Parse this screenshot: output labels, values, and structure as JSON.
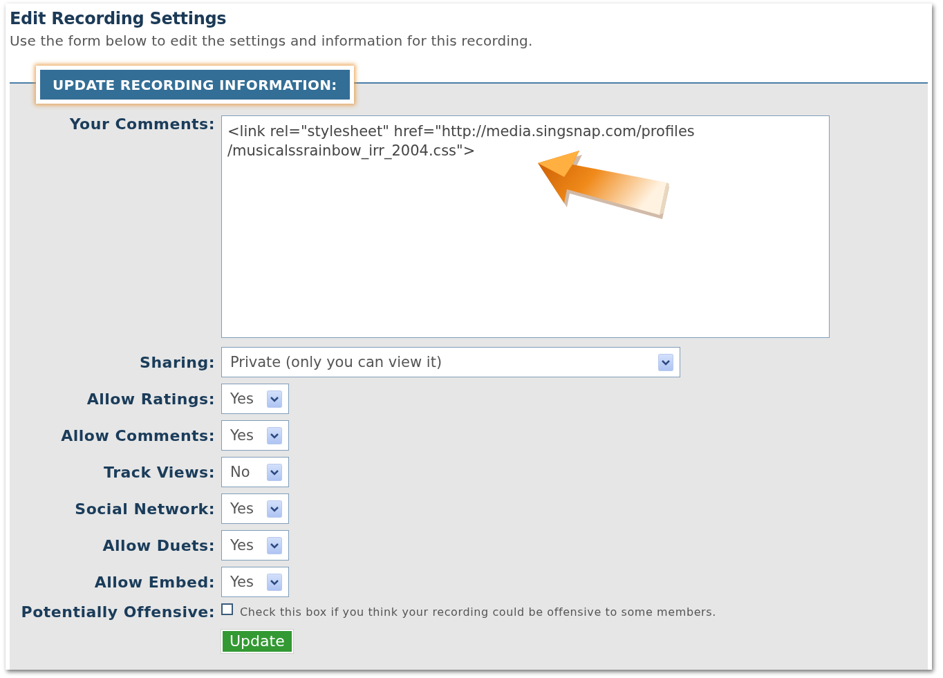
{
  "page": {
    "title": "Edit Recording Settings",
    "description": "Use the form below to edit the settings and information for this recording."
  },
  "form": {
    "legend": "UPDATE RECORDING INFORMATION:",
    "fields": [
      {
        "kind": "textarea",
        "label": "Your Comments:",
        "value": "<link rel=\"stylesheet\" href=\"http://media.singsnap.com/profiles\n/musicalssrainbow_irr_2004.css\">"
      },
      {
        "kind": "wide-select",
        "label": "Sharing:",
        "value": "Private (only you can view it)"
      },
      {
        "kind": "select",
        "label": "Allow Ratings:",
        "value": "Yes"
      },
      {
        "kind": "select",
        "label": "Allow Comments:",
        "value": "Yes"
      },
      {
        "kind": "select",
        "label": "Track Views:",
        "value": "No"
      },
      {
        "kind": "select",
        "label": "Social Network:",
        "value": "Yes"
      },
      {
        "kind": "select",
        "label": "Allow Duets:",
        "value": "Yes"
      },
      {
        "kind": "select",
        "label": "Allow Embed:",
        "value": "Yes"
      }
    ],
    "offensive": {
      "label": "Potentially Offensive:",
      "checked": false,
      "hint": "Check this box if you think your recording could be offensive to some members."
    },
    "submit": "Update"
  }
}
